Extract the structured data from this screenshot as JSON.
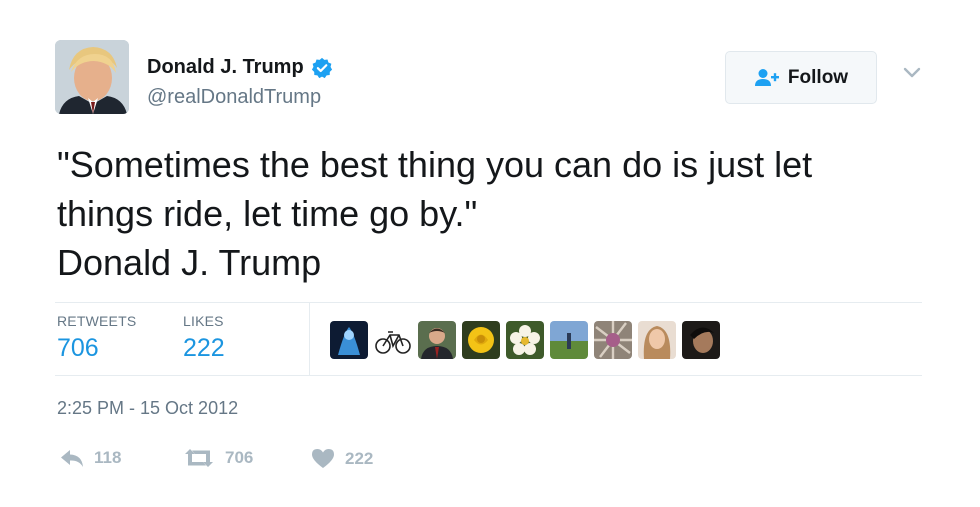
{
  "author": {
    "name": "Donald J. Trump",
    "handle": "@realDonaldTrump",
    "verified": true,
    "avatar_icon": "profile-photo"
  },
  "follow_button": {
    "label": "Follow",
    "icon": "add-user-icon"
  },
  "tweet": {
    "lines": [
      "\"Sometimes the best thing you can do is just let",
      "things ride, let time go by.\"",
      "Donald J. Trump"
    ]
  },
  "stats": {
    "retweets_label": "RETWEETS",
    "retweets_value": "706",
    "likes_label": "LIKES",
    "likes_value": "222"
  },
  "likers": [
    "blue-glow-avatar",
    "bicycle-avatar",
    "man-portrait-avatar",
    "yellow-rose-avatar",
    "white-flower-avatar",
    "field-avatar",
    "abstract-avatar",
    "woman-portrait-avatar",
    "dark-portrait-avatar"
  ],
  "timestamp": "2:25 PM - 15 Oct 2012",
  "actions": {
    "reply_count": "118",
    "retweet_count": "706",
    "like_count": "222"
  },
  "colors": {
    "accent": "#1b95e0",
    "verified": "#1da1f2",
    "muted": "#657786",
    "action": "#aab8c2"
  }
}
